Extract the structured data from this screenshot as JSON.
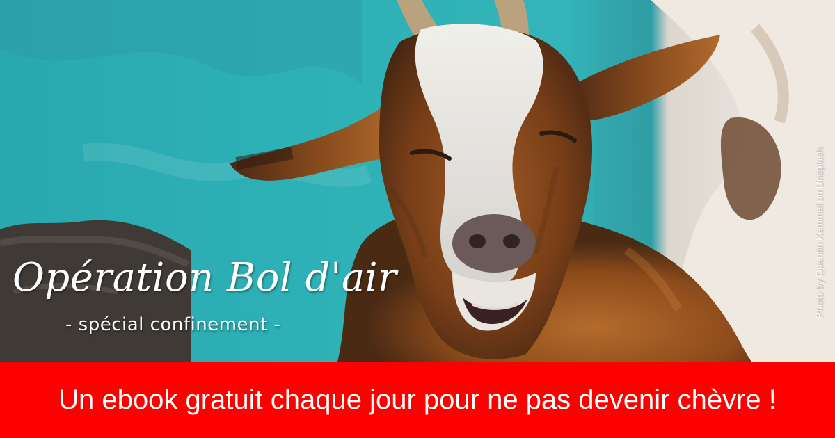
{
  "colors": {
    "accent": "#ff0000",
    "background": "#2bb0b5",
    "text": "#ffffff"
  },
  "banner": {
    "title": "Opération Bol d'air",
    "subtitle": "- spécial confinement -",
    "photo_credit": "Photo by Quentin Kemmel on Unsplash",
    "footer_message": "Un ebook gratuit chaque jour pour ne pas devenir chèvre !"
  },
  "image": {
    "subject": "goat-photo"
  }
}
